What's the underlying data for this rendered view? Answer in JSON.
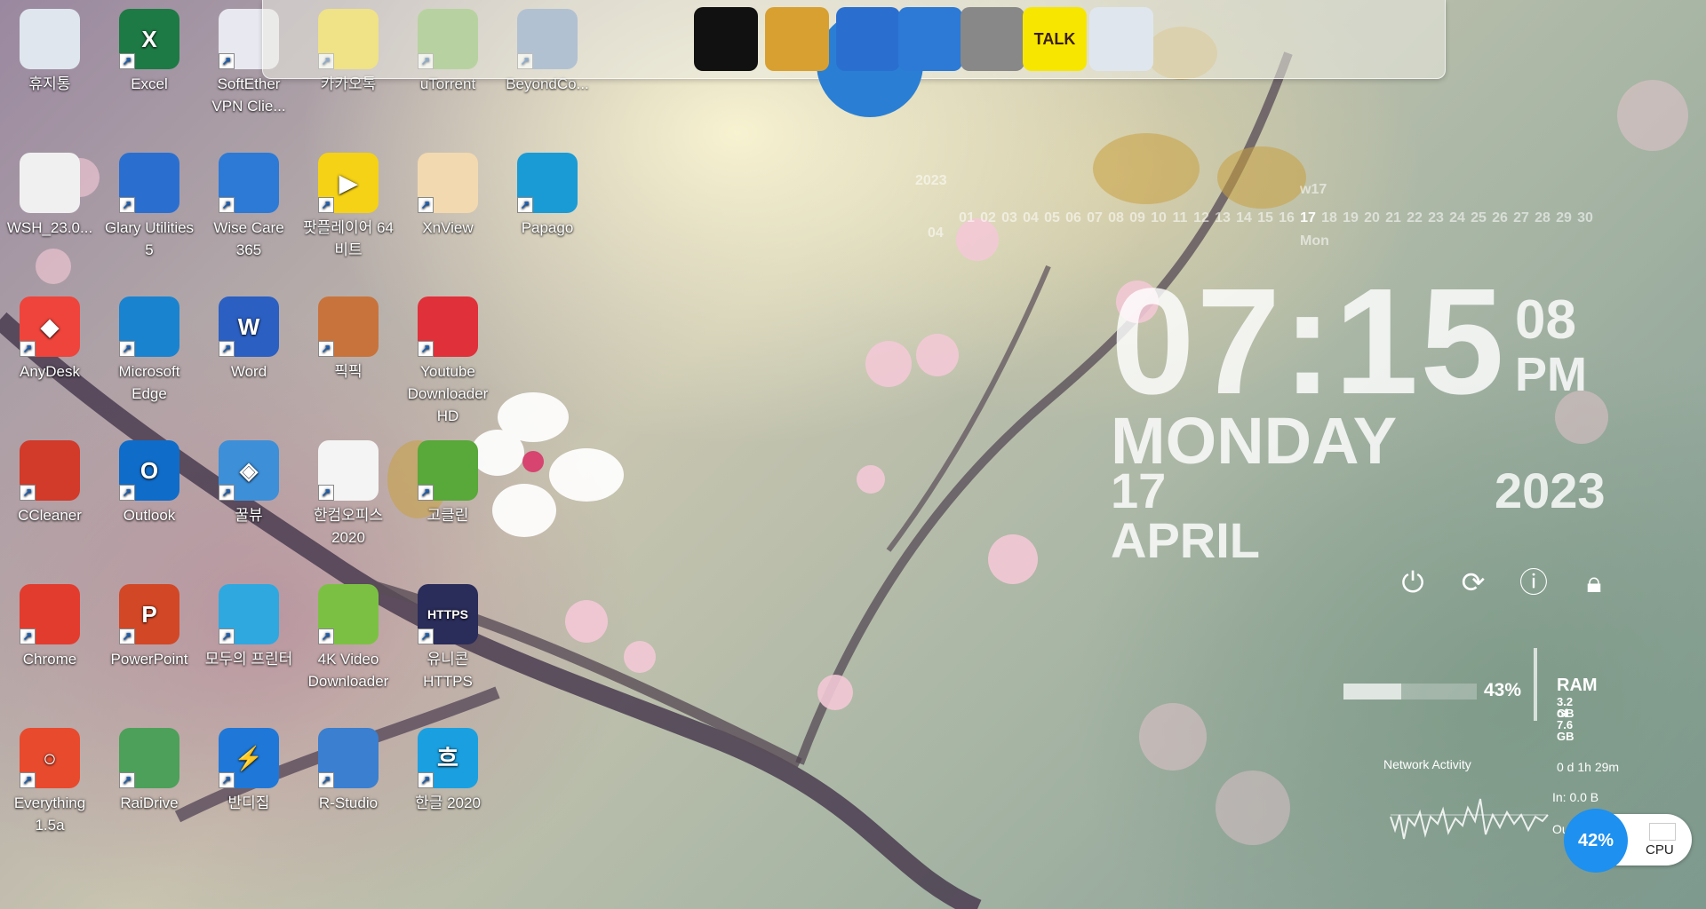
{
  "desktop_icons": [
    {
      "id": "recycle",
      "label": "휴지통",
      "icon": "recycle-bin-icon",
      "color": "#dfe6ee"
    },
    {
      "id": "excel",
      "label": "Excel",
      "icon": "excel-icon",
      "color": "#1d7a45",
      "glyph": "X"
    },
    {
      "id": "softether",
      "label": "SoftEther VPN Clie...",
      "icon": "softether-icon",
      "color": "#e8e8f0"
    },
    {
      "id": "kakaotalk-desk",
      "label": "카카오톡",
      "icon": "kakaotalk-icon",
      "color": "#f7d71a"
    },
    {
      "id": "utorrent",
      "label": "uTorrent",
      "icon": "utorrent-icon",
      "color": "#78b450"
    },
    {
      "id": "beyondcompare",
      "label": "BeyondCo...",
      "icon": "beyond-compare-icon",
      "color": "#6d8fbf"
    },
    {
      "id": "wsh",
      "label": "WSH_23.0...",
      "icon": "file-icon",
      "color": "#f0f0f0"
    },
    {
      "id": "glary",
      "label": "Glary Utilities 5",
      "icon": "glary-icon",
      "color": "#2a6fd0"
    },
    {
      "id": "wisecare",
      "label": "Wise Care 365",
      "icon": "wise-care-icon",
      "color": "#2c7ad6"
    },
    {
      "id": "potplayer",
      "label": "팟플레이어 64 비트",
      "icon": "potplayer-icon",
      "color": "#f5d215",
      "glyph": "▶"
    },
    {
      "id": "xnview",
      "label": "XnView",
      "icon": "xnview-icon",
      "color": "#f2d9b0"
    },
    {
      "id": "papago",
      "label": "Papago",
      "icon": "papago-icon",
      "color": "#1b9bd6"
    },
    {
      "id": "anydesk",
      "label": "AnyDesk",
      "icon": "anydesk-icon",
      "color": "#ef443b",
      "glyph": "◆"
    },
    {
      "id": "edge",
      "label": "Microsoft Edge",
      "icon": "edge-icon",
      "color": "#1983d0"
    },
    {
      "id": "word",
      "label": "Word",
      "icon": "word-icon",
      "color": "#2b5fc2",
      "glyph": "W"
    },
    {
      "id": "picpick",
      "label": "픽픽",
      "icon": "picpick-icon",
      "color": "#c8733c"
    },
    {
      "id": "ytdl",
      "label": "Youtube Downloader HD",
      "icon": "youtube-downloader-icon",
      "color": "#e0303a"
    },
    {
      "id": "ccleaner",
      "label": "CCleaner",
      "icon": "ccleaner-icon",
      "color": "#d23a2a"
    },
    {
      "id": "outlook",
      "label": "Outlook",
      "icon": "outlook-icon",
      "color": "#0f6cc9",
      "glyph": "O"
    },
    {
      "id": "kkulview",
      "label": "꿀뷰",
      "icon": "kkulview-icon",
      "color": "#3d8fd8",
      "glyph": "◈"
    },
    {
      "id": "hancom",
      "label": "한컴오피스 2020",
      "icon": "hancom-office-icon",
      "color": "#f4f4f4"
    },
    {
      "id": "goclean",
      "label": "고클린",
      "icon": "goclean-icon",
      "color": "#58a83a"
    },
    {
      "id": "chrome",
      "label": "Chrome",
      "icon": "chrome-icon",
      "color": "#e23c2f"
    },
    {
      "id": "powerpoint",
      "label": "PowerPoint",
      "icon": "powerpoint-icon",
      "color": "#d24726",
      "glyph": "P"
    },
    {
      "id": "modoo",
      "label": "모두의 프린터",
      "icon": "printer-icon",
      "color": "#2fa8e0"
    },
    {
      "id": "4kvideo",
      "label": "4K Video Downloader",
      "icon": "4k-video-downloader-icon",
      "color": "#7cc043"
    },
    {
      "id": "unicorn",
      "label": "유니콘 HTTPS",
      "icon": "unicorn-https-icon",
      "color": "#2a2c5a",
      "glyph": "HTTPS"
    },
    {
      "id": "everything",
      "label": "Everything 1.5a",
      "icon": "everything-icon",
      "color": "#e84a2e",
      "glyph": "○"
    },
    {
      "id": "raidrive",
      "label": "RaiDrive",
      "icon": "raidrive-icon",
      "color": "#4ca05a"
    },
    {
      "id": "bandizip",
      "label": "반디집",
      "icon": "bandizip-icon",
      "color": "#1f78d8",
      "glyph": "⚡"
    },
    {
      "id": "rstudio",
      "label": "R-Studio",
      "icon": "r-studio-icon",
      "color": "#3a7fd0"
    },
    {
      "id": "hangul",
      "label": "한글 2020",
      "icon": "hangul-icon",
      "color": "#1aa0e0",
      "glyph": "흐"
    }
  ],
  "dock": [
    {
      "icon": "globe-icon",
      "color": "#2a7fd4"
    },
    {
      "icon": "tshirt-icon",
      "color": "#111111"
    },
    {
      "icon": "tools-icon",
      "color": "#d8a030"
    },
    {
      "icon": "glary-moon-icon",
      "color": "#2a6fd0"
    },
    {
      "icon": "wise-shield-icon",
      "color": "#2c7ad6"
    },
    {
      "icon": "revo-uninstaller-icon",
      "color": "#888888"
    },
    {
      "icon": "kakaotalk-icon",
      "color": "#f7e600",
      "text": "TALK"
    },
    {
      "icon": "recycle-bin-icon",
      "color": "#dfe6ee"
    }
  ],
  "calendar": {
    "year": "2023",
    "month": "04",
    "week": "w17",
    "weekday_short": "Mon",
    "days": "01 02 03 04 05 06 07 08 09 10 11 12 13 14 15 16 17 18 19 20 21 22 23 24 25 26 27 28 29 30",
    "today": "17"
  },
  "clock": {
    "time": "07:15",
    "seconds": "08",
    "ampm": "PM",
    "day": "MONDAY",
    "date": "17 APRIL",
    "year": "2023"
  },
  "system": {
    "ram_percent": "43%",
    "ram_fill": 0.43,
    "ram_label": "RAM",
    "ram_used": "3.2 GB",
    "ram_total": "of 7.6 GB",
    "network_label": "Network Activity",
    "uptime": "0 d 1h 29m",
    "net_in": "In: 0.0 B",
    "net_out": "Out:",
    "cpu_percent": "42%",
    "cpu_label": "CPU"
  }
}
